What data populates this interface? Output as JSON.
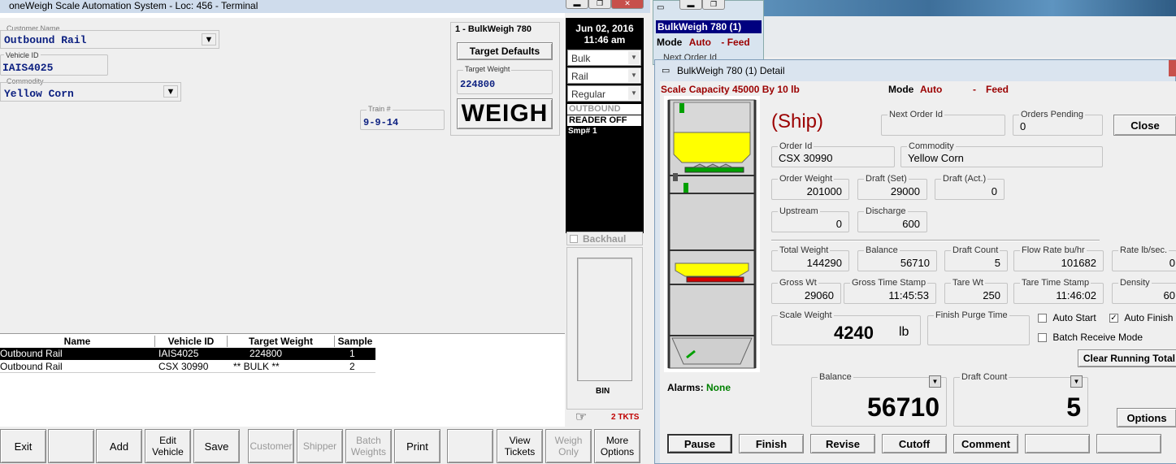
{
  "main": {
    "title": "oneWeigh Scale Automation System - Loc: 456 - Terminal",
    "customer_label": "Customer Name",
    "customer_value": "Outbound Rail",
    "vehicle_label": "Vehicle ID",
    "vehicle_value": "IAIS4025",
    "commodity_label": "Commodity",
    "commodity_value": "Yellow Corn",
    "train_label": "Train #",
    "train_value": "9-9-14",
    "scale_box_title": "1 - BulkWeigh 780",
    "target_defaults": "Target Defaults",
    "target_weight_label": "Target Weight",
    "target_weight_value": "224800",
    "weigh": "WEIGH"
  },
  "side": {
    "date": "Jun 02, 2016",
    "time": "11:46 am",
    "selects": [
      "Bulk",
      "Rail",
      "Regular"
    ],
    "status": [
      "OUTBOUND",
      "READER OFF",
      "Smp# 1"
    ],
    "backhaul": "Backhaul",
    "bin": "BIN",
    "tkts": "2 TKTS"
  },
  "table": {
    "headers": [
      "Name",
      "Vehicle ID",
      "Target Weight",
      "Sample"
    ],
    "rows": [
      {
        "name": "Outbound Rail",
        "vehicle": "IAIS4025",
        "target": "224800",
        "sample": "1"
      },
      {
        "name": "Outbound Rail",
        "vehicle": "CSX 30990",
        "target": "** BULK **",
        "sample": "2"
      }
    ]
  },
  "toolbar": [
    "Exit",
    "",
    "Add",
    "Edit Vehicle",
    "Save",
    "Customer",
    "Shipper",
    "Batch Weights",
    "Print",
    "",
    "View Tickets",
    "Weigh Only",
    "More Options"
  ],
  "bw": {
    "window_title": "BulkWeigh 780 (1)",
    "mode_label": "Mode",
    "mode_value": "Auto",
    "feed": "- Feed",
    "next_order_label": "Next Order Id"
  },
  "detail": {
    "title": "BulkWeigh 780 (1) Detail",
    "capacity": "Scale Capacity 45000 By 10 lb",
    "mode_label": "Mode",
    "mode_value": "Auto",
    "dash": "-",
    "feed": "Feed",
    "ship": "(Ship)",
    "next_order_label": "Next Order Id",
    "next_order_value": "",
    "orders_pending_label": "Orders Pending",
    "orders_pending_value": "0",
    "close": "Close",
    "order_id_label": "Order Id",
    "order_id_value": "CSX 30990",
    "commodity_label": "Commodity",
    "commodity_value": "Yellow Corn",
    "order_weight_label": "Order Weight",
    "order_weight_value": "201000",
    "draft_set_label": "Draft (Set)",
    "draft_set_value": "29000",
    "draft_act_label": "Draft (Act.)",
    "draft_act_value": "0",
    "upstream_label": "Upstream",
    "upstream_value": "0",
    "discharge_label": "Discharge",
    "discharge_value": "600",
    "total_weight_label": "Total Weight",
    "total_weight_value": "144290",
    "balance_label": "Balance",
    "balance_value": "56710",
    "draft_count_label": "Draft Count",
    "draft_count_value": "5",
    "flow_rate_label": "Flow Rate bu/hr",
    "flow_rate_value": "101682",
    "rate_label": "Rate lb/sec.",
    "rate_value": "0",
    "gross_wt_label": "Gross Wt",
    "gross_wt_value": "29060",
    "gross_ts_label": "Gross Time Stamp",
    "gross_ts_value": "11:45:53",
    "tare_wt_label": "Tare Wt",
    "tare_wt_value": "250",
    "tare_ts_label": "Tare Time Stamp",
    "tare_ts_value": "11:46:02",
    "density_label": "Density",
    "density_value": "60",
    "scale_weight_label": "Scale Weight",
    "scale_weight_value": "4240",
    "scale_weight_unit": "lb",
    "finish_purge_label": "Finish Purge Time",
    "auto_start": "Auto Start",
    "auto_start_checked": false,
    "auto_finish": "Auto Finish",
    "auto_finish_checked": true,
    "batch_receive": "Batch Receive Mode",
    "batch_receive_checked": false,
    "clear_running": "Clear Running Total",
    "alarms_label": "Alarms:",
    "alarms_value": "None",
    "big_balance_label": "Balance",
    "big_balance_value": "56710",
    "big_draft_label": "Draft Count",
    "big_draft_value": "5",
    "options": "Options",
    "buttons": [
      "Pause",
      "Finish",
      "Revise",
      "Cutoff",
      "Comment",
      "",
      ""
    ]
  },
  "colors": {
    "accent_red": "#9b0000",
    "navy": "#0b1f80",
    "green": "#008000",
    "hopper_yellow": "#ffff00"
  }
}
